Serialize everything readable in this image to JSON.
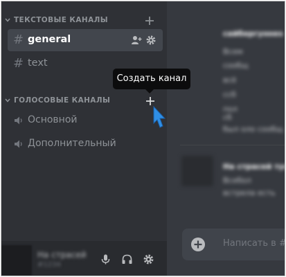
{
  "sidebar": {
    "text_category": "ТЕКСТОВЫЕ КАНАЛЫ",
    "voice_category": "ГОЛОСОВЫЕ КАНАЛЫ",
    "text_channels": [
      {
        "name": "general",
        "active": true
      },
      {
        "name": "text",
        "active": false
      }
    ],
    "voice_channels": [
      {
        "name": "Основной"
      },
      {
        "name": "Дополнительный"
      }
    ],
    "add_icon": "plus-icon"
  },
  "tooltip": {
    "text": "Создать канал"
  },
  "user_panel": {
    "name": "На страсей",
    "tag": "#1234",
    "icons": [
      "microphone-icon",
      "headphones-icon",
      "gear-icon"
    ]
  },
  "chat": {
    "messages": [
      {
        "author": "сайбергуннеs",
        "lines": [
          "Всем",
          "сообщ",
          "всё",
          "ссб",
          "пол",
          "сб",
          "был оло сообщ"
        ]
      },
      {
        "author": "На страсей тусс",
        "lines": [
          "Всебол",
          "встрела есть"
        ]
      }
    ],
    "composer_placeholder": "Написать в #ge"
  },
  "colors": {
    "sidebar_bg": "#2f3136",
    "chat_bg": "#36393f",
    "active_channel": "#42464d",
    "cursor_blue": "#2f8fe6",
    "tooltip_bg": "#0c0c0d"
  }
}
